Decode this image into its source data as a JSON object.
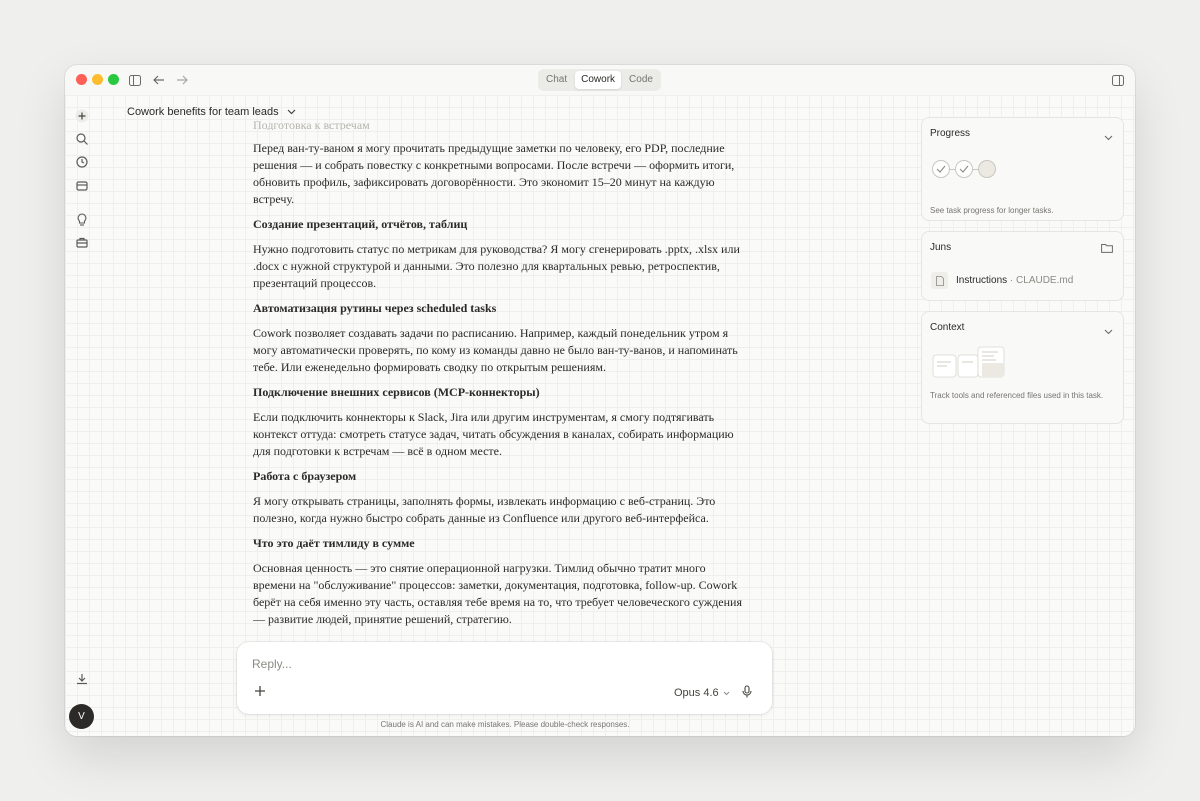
{
  "titlebar": {
    "tabs": [
      {
        "label": "Chat",
        "active": false
      },
      {
        "label": "Cowork",
        "active": true
      },
      {
        "label": "Code",
        "active": false
      }
    ]
  },
  "header": {
    "title": "Cowork benefits for team leads"
  },
  "content": {
    "cut_heading": "Подготовка к встречам",
    "sections": [
      {
        "heading": "",
        "body": "Перед ван-ту-ваном я могу прочитать предыдущие заметки по человеку, его PDP, последние решения — и собрать повестку с конкретными вопросами. После встречи — оформить итоги, обновить профиль, зафиксировать договорённости. Это экономит 15–20 минут на каждую встречу."
      },
      {
        "heading": "Создание презентаций, отчётов, таблиц",
        "body": "Нужно подготовить статус по метрикам для руководства? Я могу сгенерировать .pptx, .xlsx или .docx с нужной структурой и данными. Это полезно для квартальных ревью, ретроспектив, презентаций процессов."
      },
      {
        "heading": "Автоматизация рутины через scheduled tasks",
        "body": "Cowork позволяет создавать задачи по расписанию. Например, каждый понедельник утром я могу автоматически проверять, по кому из команды давно не было ван-ту-ванов, и напоминать тебе. Или еженедельно формировать сводку по открытым решениям."
      },
      {
        "heading": "Подключение внешних сервисов (MCP-коннекторы)",
        "body": "Если подключить коннекторы к Slack, Jira или другим инструментам, я смогу подтягивать контекст оттуда: смотреть статусе задач, читать обсуждения в каналах, собирать информацию для подготовки к встречам — всё в одном месте."
      },
      {
        "heading": "Работа с браузером",
        "body": "Я могу открывать страницы, заполнять формы, извлекать информацию с веб-страниц. Это полезно, когда нужно быстро собрать данные из Confluence или другого веб-интерфейса."
      },
      {
        "heading": "Что это даёт тимлиду в сумме",
        "body": "Основная ценность — это снятие операционной нагрузки. Тимлид обычно тратит много времени на \"обслуживание\" процессов: заметки, документация, подготовка, follow-up. Cowork берёт на себя именно эту часть, оставляя тебе время на то, что требует человеческого суждения — развитие людей, принятие решений, стратегию."
      }
    ]
  },
  "composer": {
    "placeholder": "Reply...",
    "model": "Opus 4.6"
  },
  "disclaimer": "Claude is AI and can make mistakes. Please double-check responses.",
  "panels": {
    "progress": {
      "title": "Progress",
      "subtitle": "See task progress for longer tasks.",
      "steps_completed": 2,
      "steps_total": 3
    },
    "juns": {
      "title": "Juns",
      "file_label": "Instructions",
      "file_name": "CLAUDE.md",
      "separator": " · "
    },
    "context": {
      "title": "Context",
      "subtitle": "Track tools and referenced files used in this task."
    }
  },
  "avatar": {
    "initial": "V"
  },
  "colors": {
    "background": "#efefed",
    "window": "#f8f8f6",
    "traffic_red": "#fe5f57",
    "traffic_yellow": "#febc2e",
    "traffic_green": "#28c840"
  },
  "icons": [
    "sidebar-toggle-icon",
    "back-arrow-icon",
    "forward-arrow-icon",
    "plus-icon",
    "search-icon",
    "clock-icon",
    "inbox-icon",
    "lightbulb-icon",
    "briefcase-icon",
    "download-icon",
    "chevron-down-icon",
    "folder-icon",
    "document-icon",
    "microphone-icon",
    "right-panel-icon"
  ]
}
